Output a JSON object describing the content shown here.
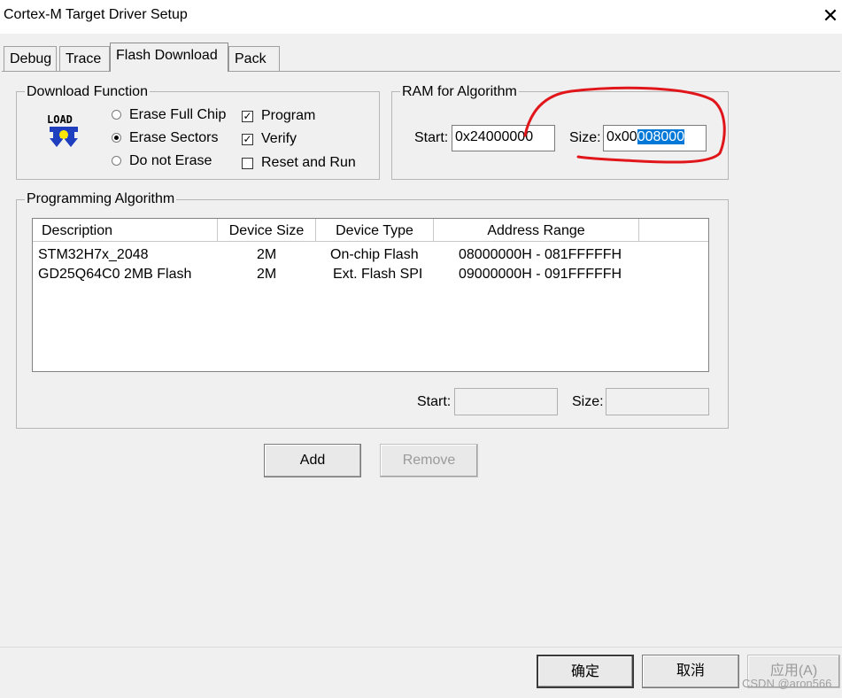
{
  "window": {
    "title": "Cortex-M Target Driver Setup"
  },
  "tabs": [
    {
      "label": "Debug",
      "active": false
    },
    {
      "label": "Trace",
      "active": false
    },
    {
      "label": "Flash Download",
      "active": true
    },
    {
      "label": "Pack",
      "active": false
    }
  ],
  "download_function": {
    "title": "Download Function",
    "icon": "load-icon",
    "radios": [
      {
        "label": "Erase Full Chip",
        "checked": false
      },
      {
        "label": "Erase Sectors",
        "checked": true
      },
      {
        "label": "Do not Erase",
        "checked": false
      }
    ],
    "checks": [
      {
        "label": "Program",
        "checked": true
      },
      {
        "label": "Verify",
        "checked": true
      },
      {
        "label": "Reset and Run",
        "checked": false
      }
    ]
  },
  "ram": {
    "title": "RAM for Algorithm",
    "start_label": "Start:",
    "start_value": "0x24000000",
    "size_label": "Size:",
    "size_value_prefix": "0x00",
    "size_value_selected": "008000"
  },
  "algorithm": {
    "title": "Programming Algorithm",
    "columns": [
      "Description",
      "Device Size",
      "Device Type",
      "Address Range"
    ],
    "rows": [
      [
        "STM32H7x_2048",
        "2M",
        "On-chip Flash",
        "08000000H - 081FFFFFH"
      ],
      [
        "GD25Q64C0 2MB Flash",
        "2M",
        "Ext. Flash SPI",
        "09000000H - 091FFFFFH"
      ]
    ],
    "start_label": "Start:",
    "start_value": "",
    "size_label": "Size:",
    "size_value": ""
  },
  "buttons": {
    "add": "Add",
    "remove": "Remove",
    "ok": "确定",
    "cancel": "取消",
    "apply": "应用(A)"
  },
  "watermark": "CSDN @aron566",
  "annotation_color": "#e0161b"
}
